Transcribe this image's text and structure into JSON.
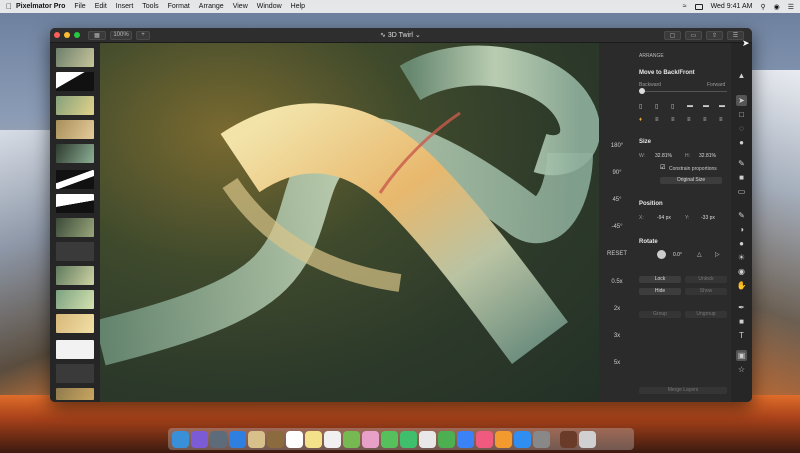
{
  "menubar": {
    "app": "Pixelmator Pro",
    "items": [
      "File",
      "Edit",
      "Insert",
      "Tools",
      "Format",
      "Arrange",
      "View",
      "Window",
      "Help"
    ],
    "clock": "Wed 9:41 AM"
  },
  "window": {
    "title": "3D Twirl",
    "zoom": "100%"
  },
  "rotate_overlay": {
    "angles": [
      "180°",
      "90°",
      "45°",
      "-45°"
    ],
    "reset": "RESET",
    "scales": [
      "0.5x",
      "2x",
      "3x",
      "5x"
    ]
  },
  "inspector": {
    "tab": "ARRANGE",
    "move_label": "Move to Back/Front",
    "backward": "Backward",
    "forward": "Forward",
    "size_label": "Size",
    "w_label": "W:",
    "w_value": "32.81%",
    "h_label": "H:",
    "h_value": "32.81%",
    "constrain": "Constrain proportions",
    "original_size": "Original Size",
    "position_label": "Position",
    "x_label": "X:",
    "x_value": "-94 px",
    "y_label": "Y:",
    "y_value": "-33 px",
    "rotate_label": "Rotate",
    "rotate_value": "0.0°",
    "lock": "Lock",
    "unlock": "Unlock",
    "hide": "Hide",
    "show": "Show",
    "group": "Group",
    "ungroup": "Ungroup",
    "merge_layers": "Merge Layers"
  },
  "colors": {
    "accent": "#3b82f6",
    "window_bg": "#2b2b2b"
  }
}
